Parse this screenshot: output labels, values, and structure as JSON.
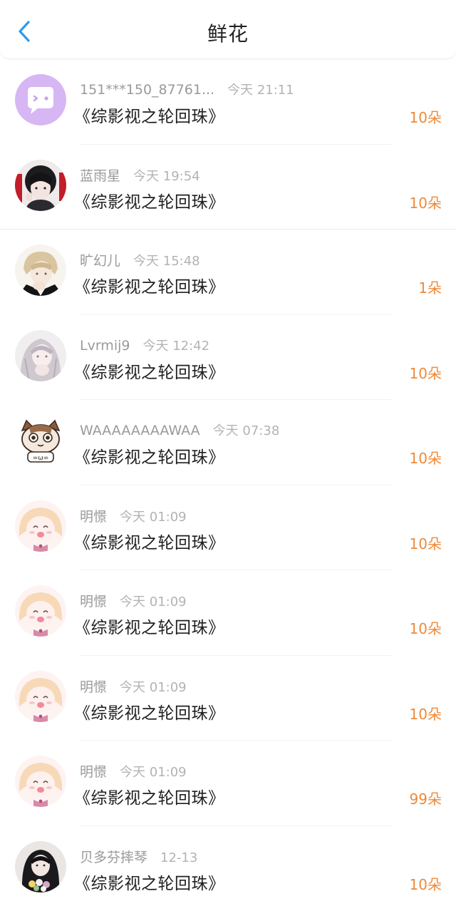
{
  "header": {
    "title": "鲜花",
    "back_icon": "chevron-left-icon",
    "accent_color": "#2b9bf0"
  },
  "flower_unit_color": "#ee8a3a",
  "rows": [
    {
      "username": "151***150_87761...",
      "time": "今天 21:11",
      "book": "《综影视之轮回珠》",
      "count": "10朵",
      "avatar": "purple-chat-bubble-avatar"
    },
    {
      "username": "蓝雨星",
      "time": "今天 19:54",
      "book": "《综影视之轮回珠》",
      "count": "10朵",
      "avatar": "anime-boy-dark-avatar"
    },
    {
      "username": "旷幻儿",
      "time": "今天 15:48",
      "book": "《综影视之轮回珠》",
      "count": "1朵",
      "avatar": "anime-boy-blond-avatar"
    },
    {
      "username": "Lvrmij9",
      "time": "今天 12:42",
      "book": "《综影视之轮回珠》",
      "count": "10朵",
      "avatar": "anime-girl-grey-avatar"
    },
    {
      "username": "WAAAAAAAAWAA",
      "time": "今天 07:38",
      "book": "《综影视之轮回珠》",
      "count": "10朵",
      "avatar": "cartoon-cat-avatar"
    },
    {
      "username": "明憬",
      "time": "今天 01:09",
      "book": "《综影视之轮回珠》",
      "count": "10朵",
      "avatar": "anime-girl-pink-avatar"
    },
    {
      "username": "明憬",
      "time": "今天 01:09",
      "book": "《综影视之轮回珠》",
      "count": "10朵",
      "avatar": "anime-girl-pink-avatar"
    },
    {
      "username": "明憬",
      "time": "今天 01:09",
      "book": "《综影视之轮回珠》",
      "count": "10朵",
      "avatar": "anime-girl-pink-avatar"
    },
    {
      "username": "明憬",
      "time": "今天 01:09",
      "book": "《综影视之轮回珠》",
      "count": "99朵",
      "avatar": "anime-girl-pink-avatar"
    },
    {
      "username": "贝多芬摔琴",
      "time": "12-13",
      "book": "《综影视之轮回珠》",
      "count": "10朵",
      "avatar": "girl-bouquet-avatar"
    }
  ]
}
